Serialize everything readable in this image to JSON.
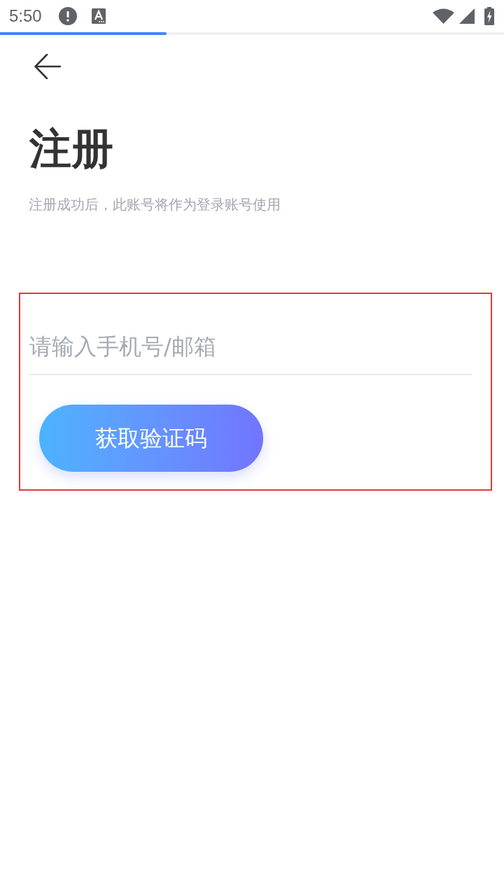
{
  "status_bar": {
    "time": "5:50"
  },
  "progress": {
    "level": 0.33
  },
  "header": {
    "title": "注册",
    "subtitle": "注册成功后，此账号将作为登录账号使用"
  },
  "form": {
    "highlighted": true,
    "account_field": {
      "placeholder": "请输入手机号/邮箱"
    },
    "code_button": {
      "label": "获取验证码"
    }
  }
}
